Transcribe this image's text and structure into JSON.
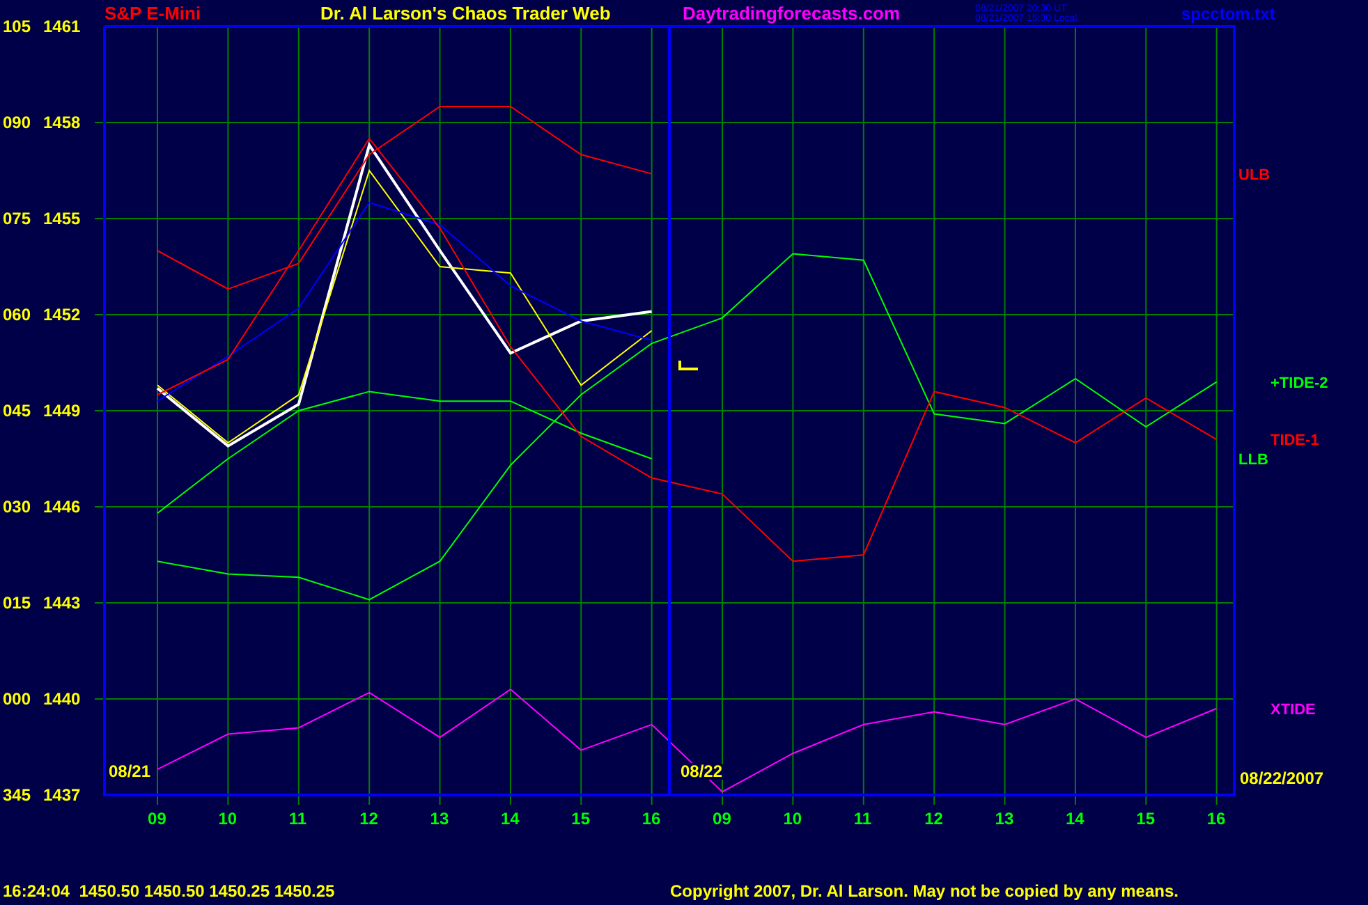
{
  "header": {
    "symbol": "S&P E-Mini",
    "title": "Dr. Al Larson's Chaos Trader Web",
    "website": "Daytradingforecasts.com",
    "timestamps": [
      "08/21/2007 20:30 UT",
      "08/21/2007 15:30 Local"
    ],
    "file": "spcctom.txt"
  },
  "chart": {
    "date_labels": [
      "08/21",
      "08/22",
      "08/22/2007"
    ],
    "cycle_scale": [
      "105",
      "090",
      "075",
      "060",
      "045",
      "030",
      "015",
      "000",
      "345"
    ],
    "chart_data": {
      "type": "line",
      "grid": true,
      "ylim": [
        1437,
        1461
      ],
      "categories": [
        "09",
        "10",
        "11",
        "12",
        "13",
        "14",
        "15",
        "16",
        "09",
        "10",
        "11",
        "12",
        "13",
        "14",
        "15",
        "16"
      ],
      "yticks": [
        1461,
        1458,
        1455,
        1452,
        1449,
        1446,
        1443,
        1440,
        1437
      ],
      "series": [
        {
          "color": "#ffffff",
          "values": [
            1449.7,
            1447.9,
            1449.2,
            1457.3,
            1454.0,
            1450.8,
            1451.8,
            1452.1,
            null,
            null,
            null,
            null,
            null,
            null,
            null,
            null
          ]
        },
        {
          "color": "#ffff00",
          "values": [
            1449.8,
            1448.0,
            1449.5,
            1456.5,
            1453.5,
            1453.3,
            1449.8,
            1451.5,
            null,
            null,
            null,
            null,
            null,
            null,
            null,
            null
          ]
        },
        {
          "color": "#0000ff",
          "values": [
            1449.3,
            1450.7,
            1452.2,
            1455.5,
            1454.8,
            1452.9,
            1451.8,
            1451.2,
            null,
            null,
            null,
            null,
            null,
            null,
            null,
            null
          ]
        },
        {
          "name": "ULB",
          "color": "#ff0000",
          "values": [
            1454.0,
            1452.8,
            1453.6,
            1457.0,
            1458.5,
            1458.5,
            1457.0,
            1456.4,
            null,
            null,
            null,
            null,
            null,
            null,
            null,
            null
          ]
        },
        {
          "name": "+TIDE-2",
          "color": "#00ff00",
          "values": [
            1444.3,
            1443.9,
            1443.8,
            1443.1,
            1444.3,
            1447.3,
            1449.5,
            1451.1,
            1451.9,
            1453.9,
            1453.7,
            1448.9,
            1448.6,
            1450.0,
            1448.5,
            1449.9
          ]
        },
        {
          "name": "LLB",
          "color": "#00ff00",
          "values": [
            1445.8,
            1447.5,
            1449.0,
            1449.6,
            1449.3,
            1449.3,
            1448.3,
            1447.5,
            null,
            null,
            null,
            null,
            null,
            null,
            null,
            null
          ]
        },
        {
          "name": "TIDE-1",
          "color": "#ff0000",
          "values": [
            1449.5,
            1450.6,
            1454.0,
            1457.5,
            1454.7,
            1451.0,
            1448.2,
            1446.9,
            1446.4,
            1444.3,
            1444.5,
            1449.6,
            1449.1,
            1448.0,
            1449.4,
            1448.1
          ]
        },
        {
          "name": "XTIDE",
          "color": "#ff00ff",
          "values": [
            1437.8,
            1438.9,
            1439.1,
            1440.2,
            1438.8,
            1440.3,
            1438.4,
            1439.2,
            1437.1,
            1438.3,
            1439.2,
            1439.6,
            1439.2,
            1440.0,
            1438.8,
            1439.7
          ]
        }
      ]
    }
  },
  "footer": {
    "quote": "16:24:04  1450.50 1450.50 1450.25 1450.25",
    "copyright": "Copyright 2007, Dr. Al Larson. May not be copied by any means."
  }
}
